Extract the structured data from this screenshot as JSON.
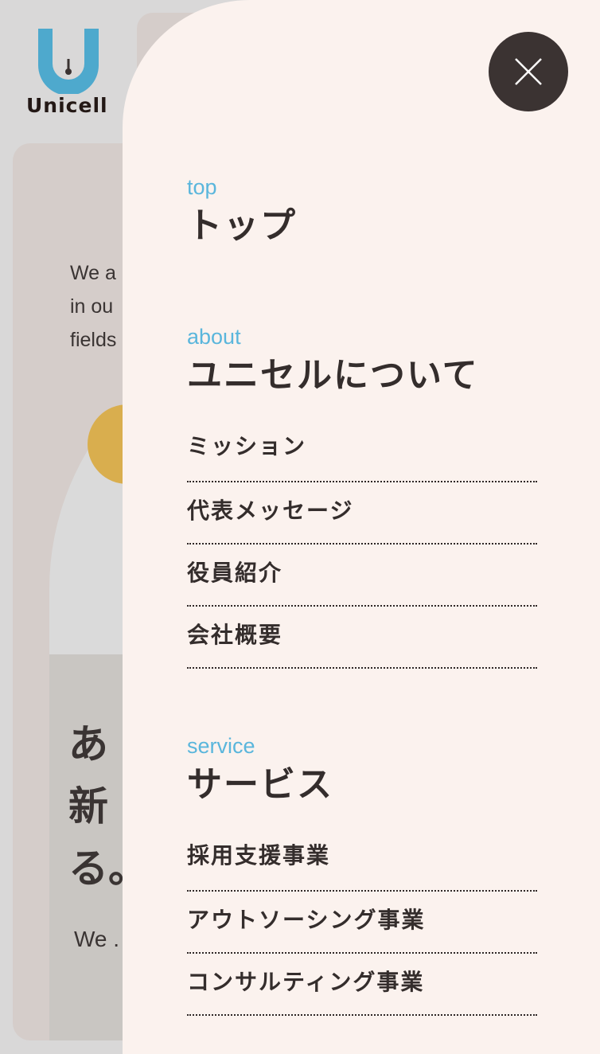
{
  "logo": {
    "text": "Unicell",
    "colors": {
      "mark": "#4ea9cd",
      "dot": "#e8334a"
    }
  },
  "background": {
    "intro_lines": "We a\nin ou\nfields",
    "heading_lines": "あ\n新\nる。",
    "sub_text": "We ."
  },
  "menu": {
    "close_icon": "close-icon",
    "sections": [
      {
        "en": "top",
        "jp": "トップ",
        "items": []
      },
      {
        "en": "about",
        "jp": "ユニセルについて",
        "items": [
          "ミッション",
          "代表メッセージ",
          "役員紹介",
          "会社概要"
        ]
      },
      {
        "en": "service",
        "jp": "サービス",
        "items": [
          "採用支援事業",
          "アウトソーシング事業",
          "コンサルティング事業"
        ]
      }
    ]
  },
  "colors": {
    "accent": "#5ab6dc",
    "panel": "#fbf2ee",
    "dark": "#3b3332",
    "yellow": "#d9ae4e"
  }
}
